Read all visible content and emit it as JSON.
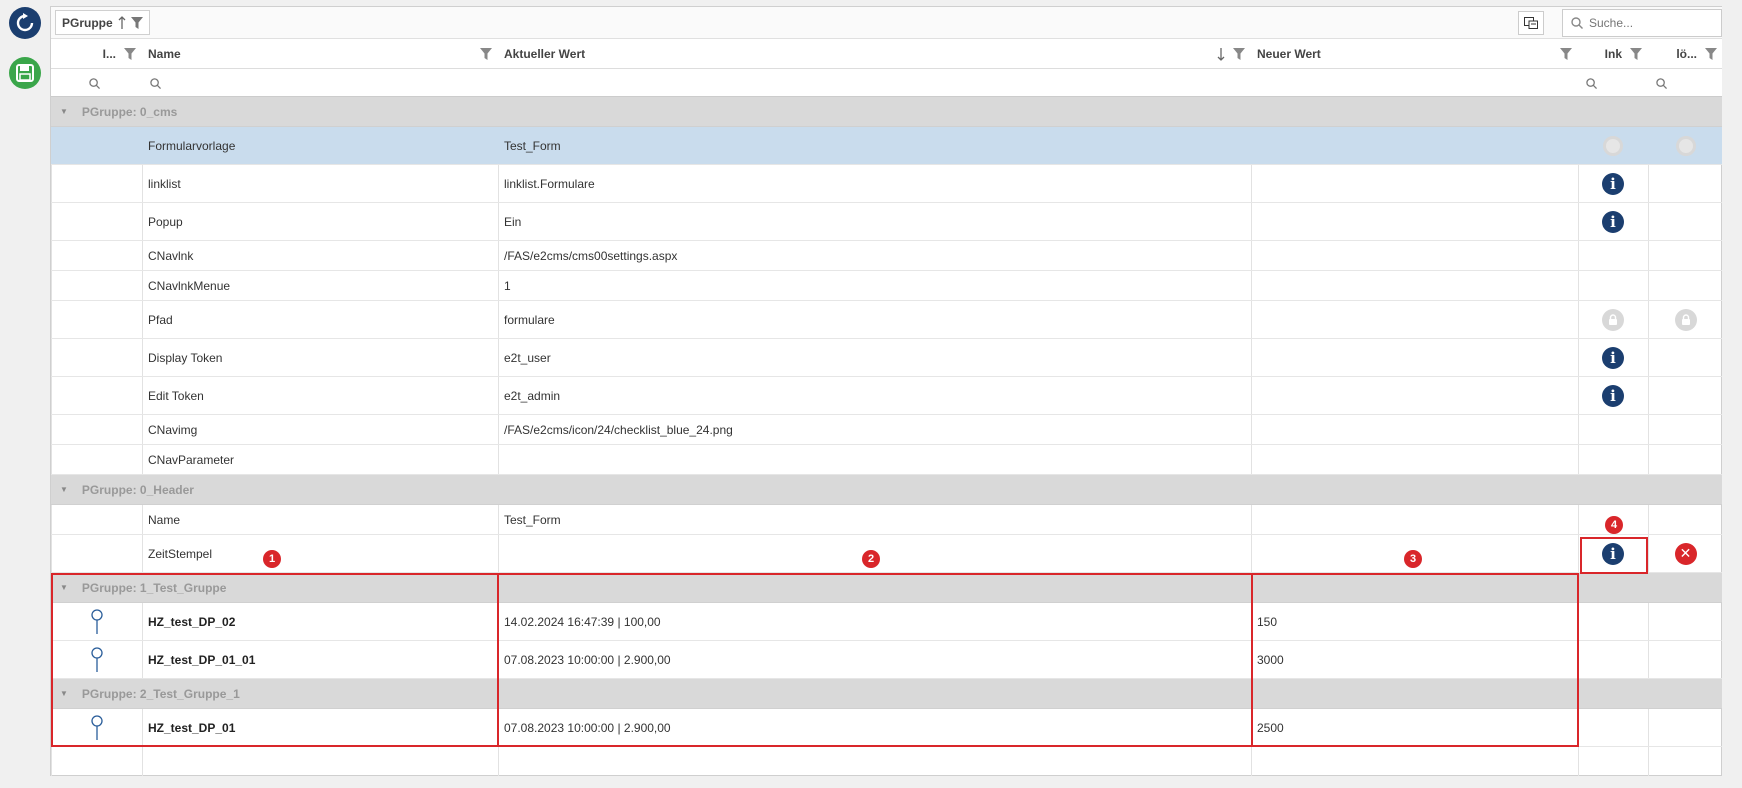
{
  "toolbar": {
    "refresh_icon": "refresh-icon",
    "save_icon": "save-icon"
  },
  "groupbar": {
    "chip_label": "PGruppe",
    "search_placeholder": "Suche..."
  },
  "columns": {
    "id_label": "I...",
    "name_label": "Name",
    "current_label": "Aktueller Wert",
    "new_label": "Neuer Wert",
    "ink_label": "Ink",
    "del_label": "lö..."
  },
  "groups": [
    {
      "title": "PGruppe: 0_cms"
    },
    {
      "title": "PGruppe: 0_Header"
    },
    {
      "title": "PGruppe: 1_Test_Gruppe"
    },
    {
      "title": "PGruppe: 2_Test_Gruppe_1"
    }
  ],
  "rows": [
    {
      "name": "Formularvorlage",
      "current": "Test_Form",
      "new": ""
    },
    {
      "name": "linklist",
      "current": "linklist.Formulare",
      "new": ""
    },
    {
      "name": "Popup",
      "current": "Ein",
      "new": ""
    },
    {
      "name": "CNavlnk",
      "current": "/FAS/e2cms/cms00settings.aspx",
      "new": ""
    },
    {
      "name": "CNavlnkMenue",
      "current": "1",
      "new": ""
    },
    {
      "name": "Pfad",
      "current": "formulare",
      "new": ""
    },
    {
      "name": "Display Token",
      "current": "e2t_user",
      "new": ""
    },
    {
      "name": "Edit Token",
      "current": "e2t_admin",
      "new": ""
    },
    {
      "name": "CNavimg",
      "current": "/FAS/e2cms/icon/24/checklist_blue_24.png",
      "new": ""
    },
    {
      "name": "CNavParameter",
      "current": "",
      "new": ""
    },
    {
      "name": "Name",
      "current": "Test_Form",
      "new": ""
    },
    {
      "name": "ZeitStempel",
      "current": "",
      "new": ""
    },
    {
      "name": "HZ_test_DP_02",
      "current": "14.02.2024 16:47:39 | 100,00",
      "new": "150"
    },
    {
      "name": "HZ_test_DP_01_01",
      "current": "07.08.2023 10:00:00 | 2.900,00",
      "new": "3000"
    },
    {
      "name": "HZ_test_DP_01",
      "current": "07.08.2023 10:00:00 | 2.900,00",
      "new": "2500"
    }
  ],
  "badges": [
    "1",
    "2",
    "3",
    "4"
  ],
  "colors": {
    "navy": "#1b3e6f",
    "green": "#3aa64a",
    "red": "#d9262a",
    "selected": "#c9dced"
  }
}
